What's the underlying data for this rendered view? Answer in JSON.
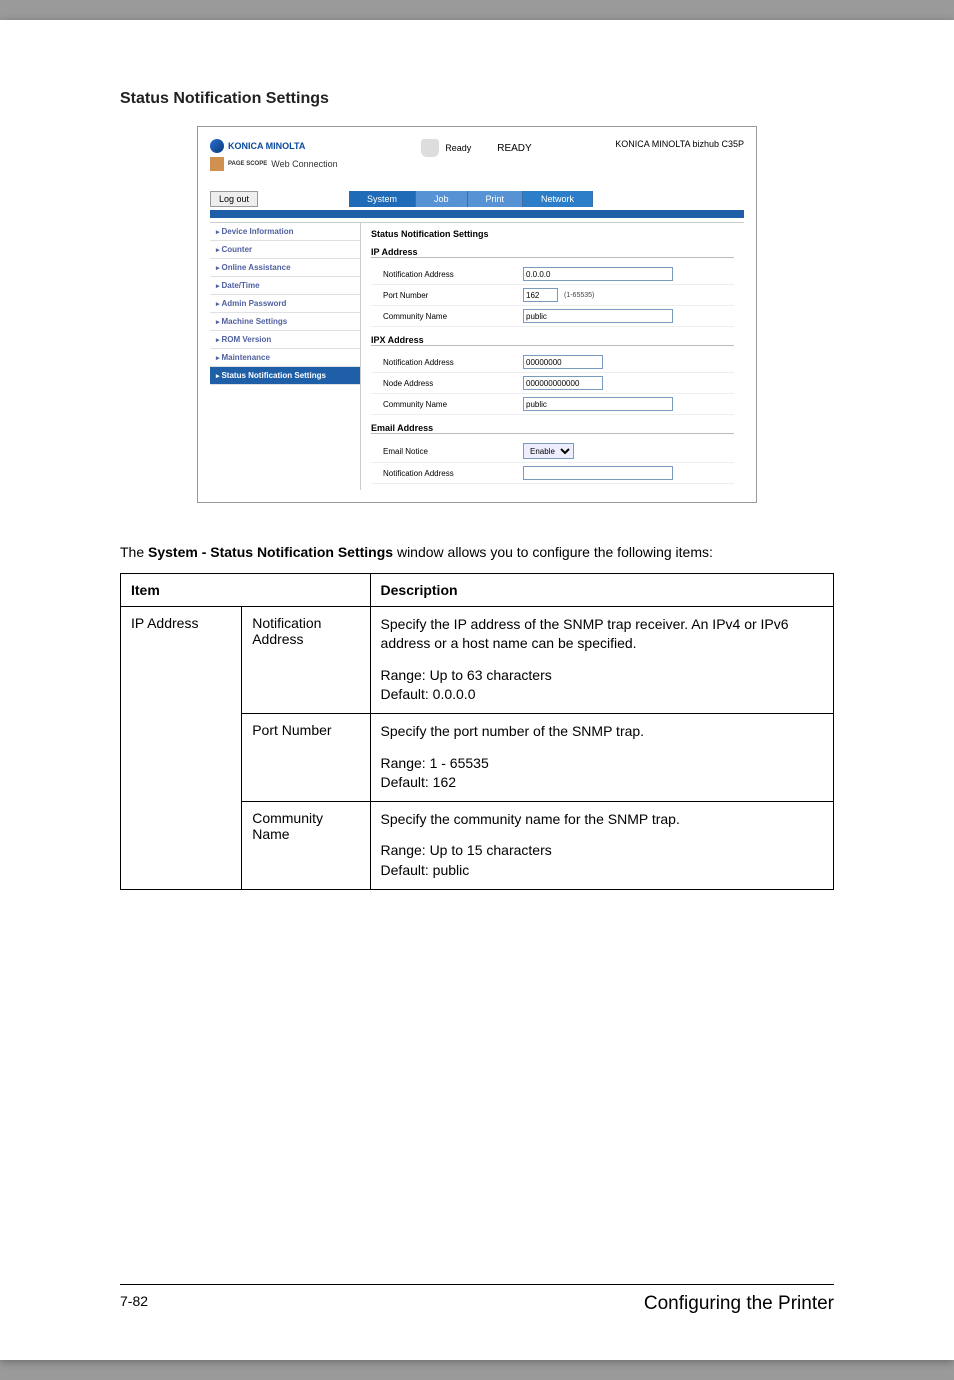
{
  "page": {
    "title": "Status Notification Settings",
    "description_prefix": "The ",
    "description_bold": "System - Status Notification Settings",
    "description_suffix": " window allows you to configure the following items:"
  },
  "screenshot": {
    "logo_text": "KONICA MINOLTA",
    "web_connection": "Web Connection",
    "pagescope": "PAGE SCOPE",
    "ready_small": "Ready",
    "ready_big": "READY",
    "model": "KONICA MINOLTA bizhub C35P",
    "logout": "Log out",
    "tabs": [
      "System",
      "Job",
      "Print",
      "Network"
    ],
    "sidebar": [
      "Device Information",
      "Counter",
      "Online Assistance",
      "Date/Time",
      "Admin Password",
      "Machine Settings",
      "ROM Version",
      "Maintenance",
      "Status Notification Settings"
    ],
    "main": {
      "heading": "Status Notification Settings",
      "ip_section": "IP Address",
      "notif_addr_label": "Notification Address",
      "notif_addr_value": "0.0.0.0",
      "port_label": "Port Number",
      "port_value": "162",
      "port_hint": "(1-65535)",
      "community_label": "Community Name",
      "community_value": "public",
      "ipx_section": "IPX Address",
      "ipx_notif_label": "Notification Address",
      "ipx_notif_value": "00000000",
      "node_label": "Node Address",
      "node_value": "000000000000",
      "ipx_community_label": "Community Name",
      "ipx_community_value": "public",
      "email_section": "Email Address",
      "email_notice_label": "Email Notice",
      "email_notice_value": "Enable",
      "email_notif_label": "Notification Address",
      "email_notif_value": ""
    }
  },
  "table": {
    "headers": {
      "item": "Item",
      "description": "Description"
    },
    "rows": [
      {
        "item": "IP Address",
        "subrows": [
          {
            "sub": "Notification Address",
            "desc1": "Specify the IP address of the SNMP trap receiver. An IPv4 or IPv6 address or a host name can be specified.",
            "desc2": "Range: Up to 63 characters\nDefault: 0.0.0.0"
          },
          {
            "sub": "Port Number",
            "desc1": "Specify the port number of the SNMP trap.",
            "desc2": "Range: 1 - 65535\nDefault: 162"
          },
          {
            "sub": "Community Name",
            "desc1": "Specify the community name for the SNMP trap.",
            "desc2": "Range: Up to 15 characters\nDefault: public"
          }
        ]
      }
    ]
  },
  "footer": {
    "left": "7-82",
    "right": "Configuring the Printer"
  }
}
